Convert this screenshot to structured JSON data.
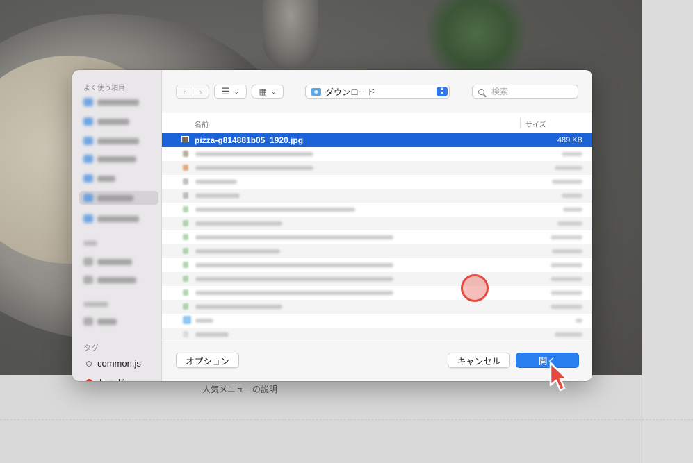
{
  "background": {
    "caption": "人気メニューの説明"
  },
  "dialog": {
    "sidebar": {
      "favorites_header": "よく使う項目",
      "tags_header": "タグ",
      "tags": [
        {
          "label": "common.js",
          "color": "#ffffff"
        },
        {
          "label": "レッド",
          "color": "#e0392b"
        }
      ]
    },
    "toolbar": {
      "back_icon": "chevron-left-icon",
      "forward_icon": "chevron-right-icon",
      "view_list_icon": "list-view-icon",
      "view_grid_icon": "grid-view-icon",
      "location": "ダウンロード",
      "search_placeholder": "検索"
    },
    "file_list": {
      "columns": {
        "name": "名前",
        "size": "サイズ"
      },
      "selected_file": {
        "name": "pizza-g814881b05_1920.jpg",
        "size": "489 KB"
      }
    },
    "footer": {
      "options_label": "オプション",
      "cancel_label": "キャンセル",
      "open_label": "開く"
    }
  },
  "colors": {
    "accent": "#2a7ff0",
    "selection": "#1b63d6",
    "click_highlight": "#e5483e"
  }
}
